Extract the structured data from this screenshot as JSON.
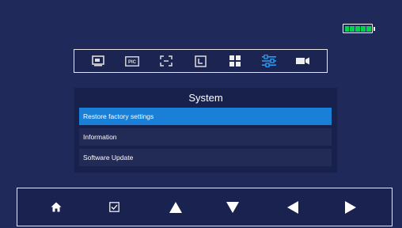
{
  "colors": {
    "background": "#1f2a5a",
    "panel": "#18214b",
    "selected": "#1a7fd6",
    "battery": "#00d44a"
  },
  "status": {
    "battery_icon": "battery-full-icon",
    "battery_level": 1.0
  },
  "toolbar": {
    "icons": [
      "monitor-icon",
      "pic-icon",
      "zoom-frame-icon",
      "timer-icon",
      "grid-icon",
      "settings-sliders-icon",
      "camera-icon"
    ],
    "pic_label": "PIC",
    "active_index": 5
  },
  "menu": {
    "title": "System",
    "items": [
      {
        "label": "Restore factory settings",
        "selected": true
      },
      {
        "label": "Information",
        "selected": false
      },
      {
        "label": "Software Update",
        "selected": false
      }
    ]
  },
  "navigation": {
    "buttons": [
      "home-icon",
      "checkbox-icon",
      "up-arrow-icon",
      "down-arrow-icon",
      "left-arrow-icon",
      "right-arrow-icon"
    ]
  }
}
